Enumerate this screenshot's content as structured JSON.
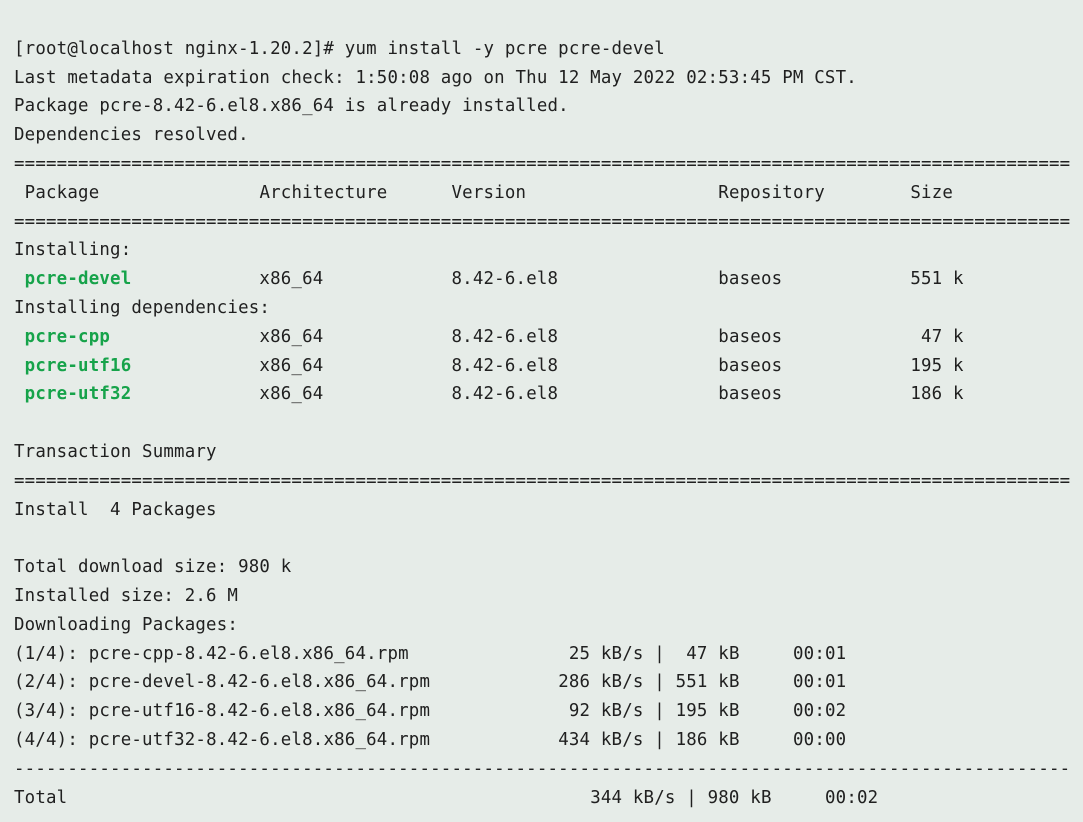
{
  "prompt": "[root@localhost nginx-1.20.2]# ",
  "command": "yum install -y pcre pcre-devel",
  "meta_line": "Last metadata expiration check: 1:50:08 ago on Thu 12 May 2022 02:53:45 PM CST.",
  "already_installed": "Package pcre-8.42-6.el8.x86_64 is already installed.",
  "deps_resolved": "Dependencies resolved.",
  "hr_eq": "===================================================================================================",
  "hr_dash": "---------------------------------------------------------------------------------------------------",
  "header": {
    "package": "Package",
    "arch": "Architecture",
    "version": "Version",
    "repo": "Repository",
    "size": "Size"
  },
  "sections": {
    "installing": "Installing:",
    "installing_deps": "Installing dependencies:",
    "tx_summary": "Transaction Summary",
    "install_count": "Install  4 Packages",
    "total_dl": "Total download size: 980 k",
    "inst_size": "Installed size: 2.6 M",
    "dl_header": "Downloading Packages:",
    "total_label": "Total"
  },
  "pkgs": {
    "devel": {
      "name": "pcre-devel",
      "arch": "x86_64",
      "ver": "8.42-6.el8",
      "repo": "baseos",
      "size": "551 k"
    },
    "cpp": {
      "name": "pcre-cpp",
      "arch": "x86_64",
      "ver": "8.42-6.el8",
      "repo": "baseos",
      "size": "47 k"
    },
    "utf16": {
      "name": "pcre-utf16",
      "arch": "x86_64",
      "ver": "8.42-6.el8",
      "repo": "baseos",
      "size": "195 k"
    },
    "utf32": {
      "name": "pcre-utf32",
      "arch": "x86_64",
      "ver": "8.42-6.el8",
      "repo": "baseos",
      "size": "186 k"
    }
  },
  "downloads": {
    "d1": {
      "idx": "(1/4):",
      "file": "pcre-cpp-8.42-6.el8.x86_64.rpm",
      "rate": "25 kB/s",
      "size": "47 kB",
      "time": "00:01"
    },
    "d2": {
      "idx": "(2/4):",
      "file": "pcre-devel-8.42-6.el8.x86_64.rpm",
      "rate": "286 kB/s",
      "size": "551 kB",
      "time": "00:01"
    },
    "d3": {
      "idx": "(3/4):",
      "file": "pcre-utf16-8.42-6.el8.x86_64.rpm",
      "rate": "92 kB/s",
      "size": "195 kB",
      "time": "00:02"
    },
    "d4": {
      "idx": "(4/4):",
      "file": "pcre-utf32-8.42-6.el8.x86_64.rpm",
      "rate": "434 kB/s",
      "size": "186 kB",
      "time": "00:00"
    }
  },
  "total_row": {
    "rate": "344 kB/s",
    "size": "980 kB",
    "time": "00:02"
  }
}
